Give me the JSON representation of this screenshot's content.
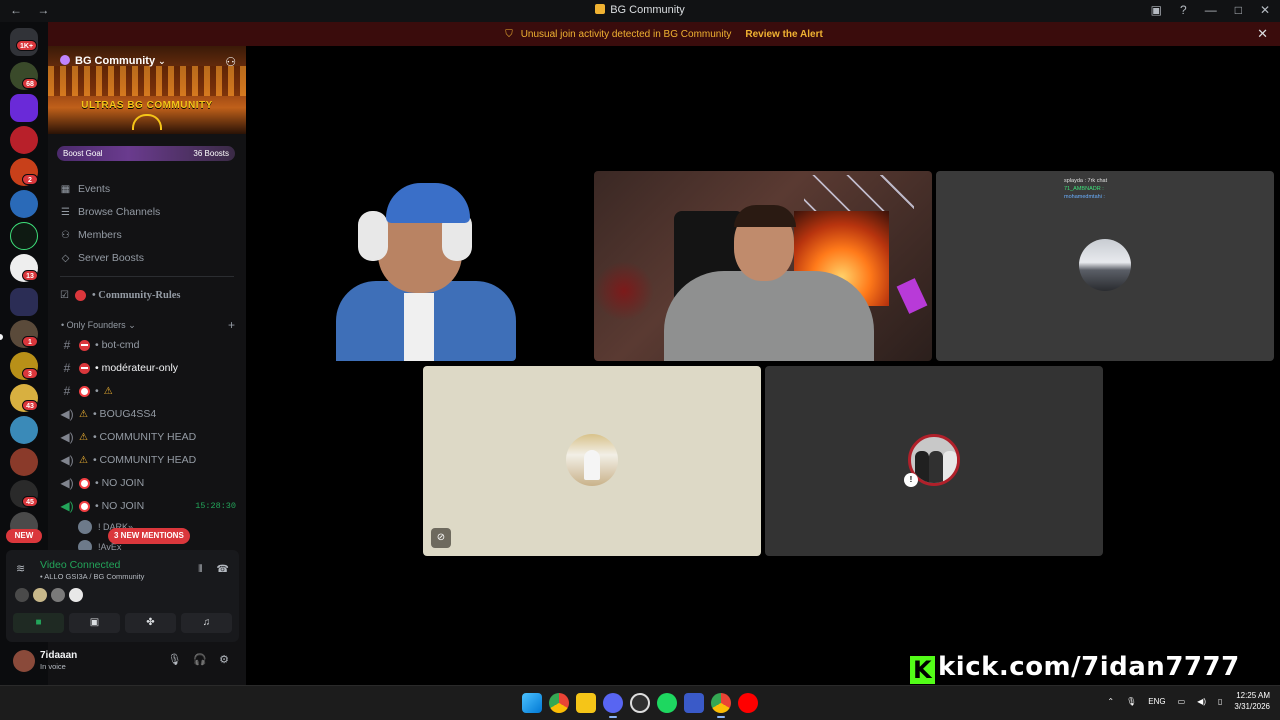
{
  "window": {
    "title": "BG Community",
    "nav": "← →"
  },
  "alert": {
    "message": "Unusual join activity detected in BG Community",
    "action": "Review the Alert"
  },
  "rail": {
    "home_badge": "1K+",
    "badges": [
      "68",
      "2",
      "13",
      "1",
      "3",
      "43",
      "45"
    ],
    "new_label": "NEW"
  },
  "server": {
    "name": "BG Community",
    "banner_text": "ULTRAS BG COMMUNITY",
    "boost_goal": "Boost Goal",
    "boost_count": "36 Boosts"
  },
  "nav_items": [
    {
      "icon": "calendar-icon",
      "label": "Events"
    },
    {
      "icon": "browse-icon",
      "label": "Browse Channels"
    },
    {
      "icon": "members-icon",
      "label": "Members"
    },
    {
      "icon": "boost-icon",
      "label": "Server Boosts"
    }
  ],
  "rules_channel": "• Community-Rules",
  "category": "• Only Founders",
  "channels": [
    {
      "type": "text",
      "marker": "no-entry",
      "name": "• bot-cmd",
      "active": false
    },
    {
      "type": "text",
      "marker": "no-entry",
      "name": "• modérateur-only",
      "active": true
    },
    {
      "type": "text",
      "marker": "ban",
      "name": "•",
      "warn": true,
      "active": false
    },
    {
      "type": "voice",
      "marker": "warn",
      "name": "• BOUG4SS4",
      "active": false
    },
    {
      "type": "voice",
      "marker": "warn",
      "name": "• COMMUNITY HEAD",
      "active": false
    },
    {
      "type": "voice",
      "marker": "warn",
      "name": "• COMMUNITY HEAD",
      "active": false
    },
    {
      "type": "voice",
      "marker": "ban",
      "name": "• NO JOIN",
      "active": false
    },
    {
      "type": "voice-live",
      "marker": "ban",
      "name": "• NO JOIN",
      "time": "15:28:30",
      "active": false
    }
  ],
  "voice_users": [
    "! DARK»",
    "!AvEx"
  ],
  "mentions_pill": "3 NEW MENTIONS",
  "voice": {
    "status": "Video Connected",
    "location": "• ALLO GSI3A / BG Community"
  },
  "user": {
    "name": "7idaaan",
    "status": "In voice"
  },
  "stream": {
    "chat_lines": [
      "splayda : 7rk chat",
      "71_AMBNADR : ",
      "mohamedmtahi : "
    ],
    "kick_url": "kick.com/7idan7777"
  },
  "tray": {
    "lang": "ENG",
    "time": "12:25 AM",
    "date": "3/31/2026"
  },
  "colors": {
    "accent_green": "#23a55a",
    "alert_red": "#da373c",
    "kick_green": "#53fc18",
    "warning": "#f0b232"
  }
}
